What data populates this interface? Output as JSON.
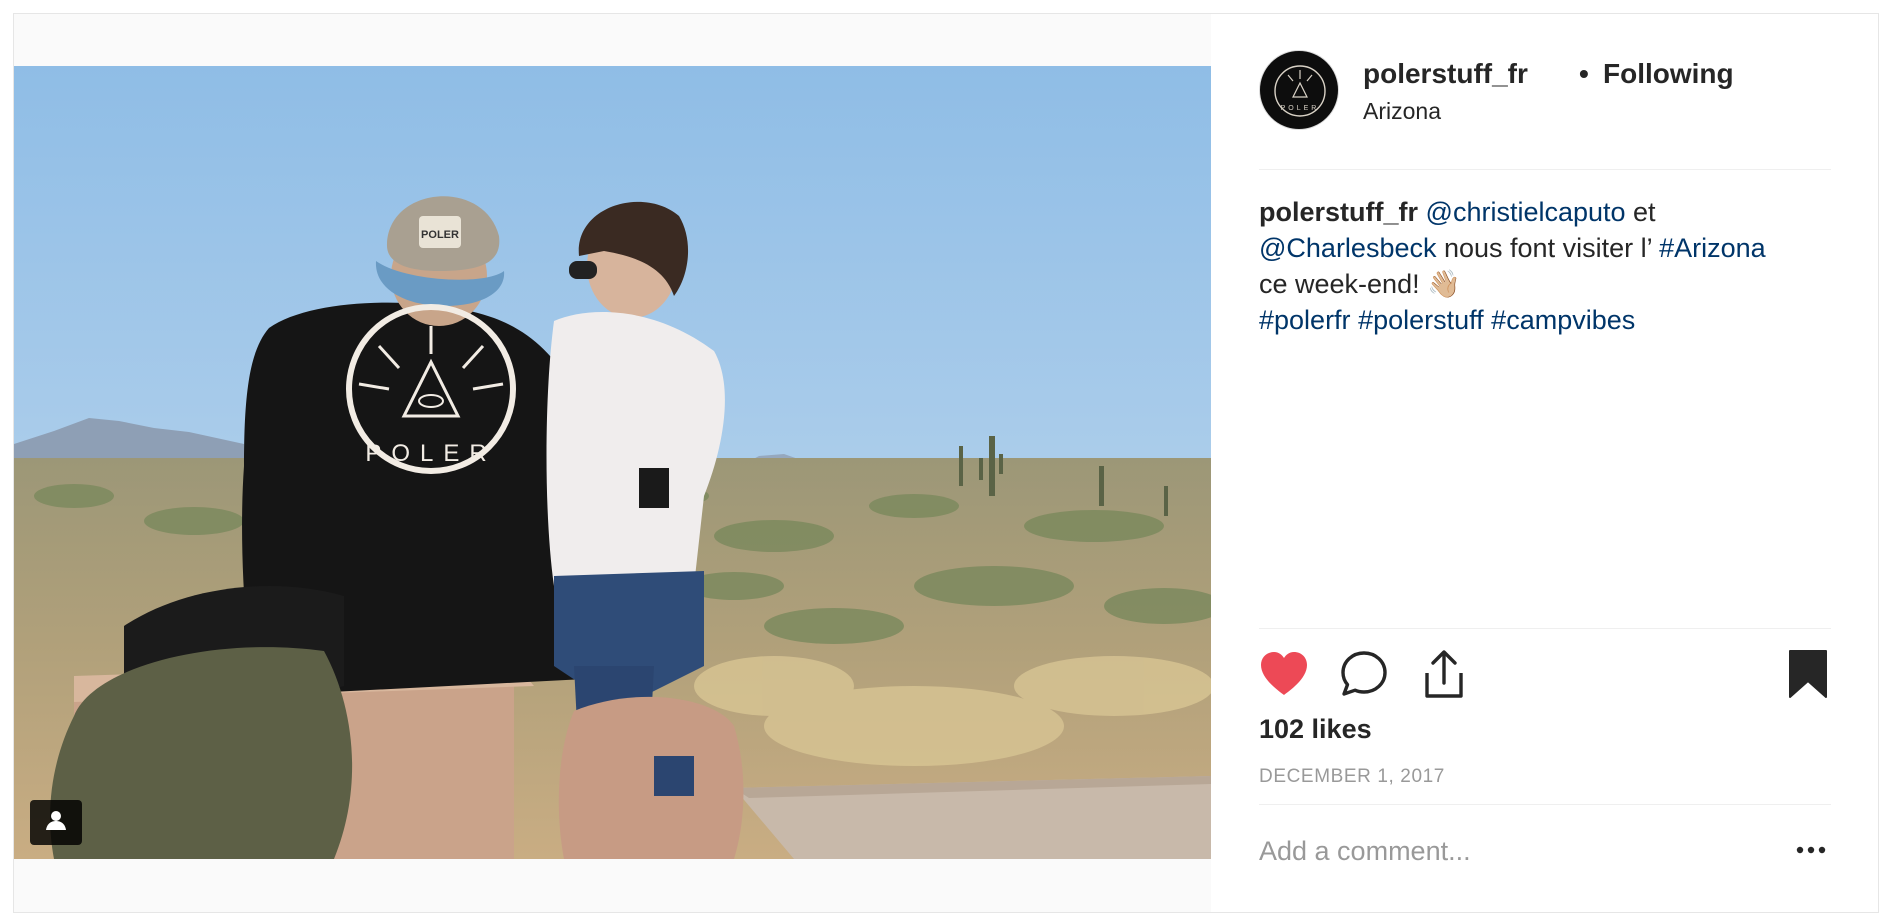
{
  "post": {
    "author": {
      "username": "polerstuff_fr",
      "follow_separator": "•",
      "follow_state": "Following",
      "location": "Arizona",
      "avatar_letters": "POLER"
    },
    "photo": {
      "shirt_logo_letters": "POLER",
      "cap_logo_text": "POLER",
      "tag_badge_icon": "person-tag-icon"
    },
    "caption": {
      "username": "polerstuff_fr",
      "mention_1": "@christielcaputo",
      "text_1": " et",
      "mention_2": "@Charlesbeck",
      "text_2": " nous font visiter l’ ",
      "hashtag_1": "#Arizona",
      "text_3": "ce week-end! ",
      "emoji": "👋🏼",
      "hashtag_2": "#polerfr",
      "hashtag_3": "#polerstuff",
      "hashtag_4": "#campvibes"
    },
    "actions": {
      "like_icon": "heart-filled-icon",
      "comment_icon": "comment-icon",
      "share_icon": "share-icon",
      "save_icon": "bookmark-filled-icon",
      "liked": true,
      "saved": true
    },
    "likes_text": "102 likes",
    "date": "DECEMBER 1, 2017",
    "comment": {
      "placeholder": "Add a comment...",
      "value": "",
      "more_icon": "more-options-icon"
    },
    "colors": {
      "like_red": "#ed4956",
      "link_blue": "#003569",
      "muted_gray": "#999999",
      "divider": "#efefef"
    }
  }
}
